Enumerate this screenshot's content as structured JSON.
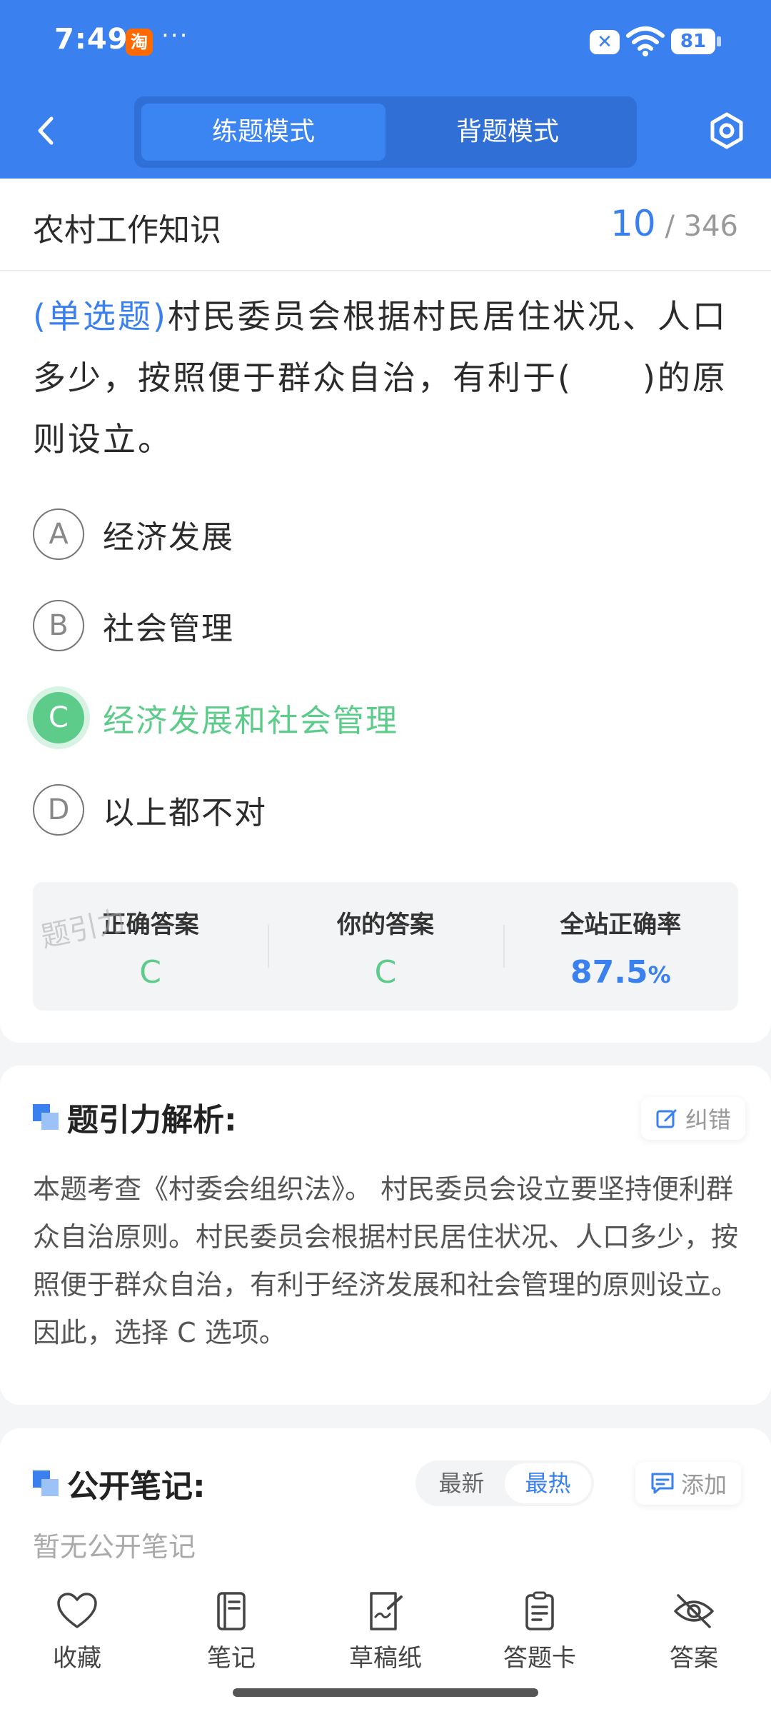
{
  "status_bar": {
    "time": "7:49",
    "app_badge": "淘",
    "more": "···",
    "battery": "81"
  },
  "nav": {
    "modes": [
      "练题模式",
      "背题模式"
    ],
    "active_mode": 0
  },
  "question": {
    "category": "农村工作知识",
    "current": "10",
    "total": "/ 346",
    "type": "(单选题)",
    "text": "村民委员会根据村民居住状况、人口多少，按照便于群众自治，有利于(　　)的原则设立。",
    "options": [
      {
        "letter": "A",
        "text": "经济发展"
      },
      {
        "letter": "B",
        "text": "社会管理"
      },
      {
        "letter": "C",
        "text": "经济发展和社会管理"
      },
      {
        "letter": "D",
        "text": "以上都不对"
      }
    ],
    "selected": "C"
  },
  "result": {
    "correct_label": "正确答案",
    "correct_value": "C",
    "yours_label": "你的答案",
    "yours_value": "C",
    "rate_label": "全站正确率",
    "rate_value": "87.5",
    "rate_unit": "%",
    "watermark": "题引力"
  },
  "analysis": {
    "title": "题引力解析:",
    "report_label": "纠错",
    "text": "本题考查《村委会组织法》。 村民委员会设立要坚持便利群众自治原则。村民委员会根据村民居住状况、人口多少，按照便于群众自治，有利于经济发展和社会管理的原则设立。 因此，选择 C 选项。"
  },
  "notes": {
    "title": "公开笔记:",
    "sort_options": [
      "最新",
      "最热"
    ],
    "active_sort": 1,
    "add_label": "添加",
    "empty_text": "暂无公开笔记"
  },
  "toolbar": {
    "items": [
      {
        "label": "收藏",
        "icon": "heart-icon"
      },
      {
        "label": "笔记",
        "icon": "notebook-icon"
      },
      {
        "label": "草稿纸",
        "icon": "draft-paper-icon"
      },
      {
        "label": "答题卡",
        "icon": "answer-card-icon"
      },
      {
        "label": "答案",
        "icon": "eye-off-icon"
      }
    ]
  },
  "colors": {
    "primary": "#3a80ee",
    "correct": "#5dcc8b",
    "background": "#f4f5f7"
  }
}
